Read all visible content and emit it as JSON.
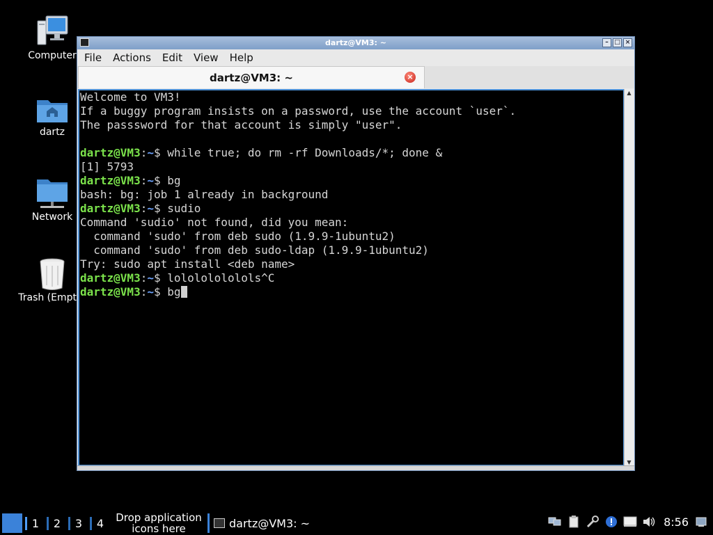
{
  "desktop": {
    "icons": [
      {
        "label": "Computer",
        "icon": "computer-icon"
      },
      {
        "label": "dartz",
        "icon": "home-folder-icon"
      },
      {
        "label": "Network",
        "icon": "network-folder-icon"
      },
      {
        "label": "Trash (Empty)",
        "icon": "trash-icon"
      }
    ]
  },
  "window": {
    "title": "dartz@VM3: ~",
    "menu": [
      "File",
      "Actions",
      "Edit",
      "View",
      "Help"
    ],
    "tab": {
      "label": "dartz@VM3: ~"
    }
  },
  "terminal": {
    "prompt_user": "dartz@VM3",
    "prompt_sep": ":",
    "prompt_path": "~",
    "prompt_end": "$ ",
    "lines": [
      {
        "type": "out",
        "text": "Welcome to VM3!"
      },
      {
        "type": "out",
        "text": "If a buggy program insists on a password, use the account `user`."
      },
      {
        "type": "out",
        "text": "The passsword for that account is simply \"user\"."
      },
      {
        "type": "out",
        "text": ""
      },
      {
        "type": "cmd",
        "text": "while true; do rm -rf Downloads/*; done &"
      },
      {
        "type": "out",
        "text": "[1] 5793"
      },
      {
        "type": "cmd",
        "text": "bg"
      },
      {
        "type": "out",
        "text": "bash: bg: job 1 already in background"
      },
      {
        "type": "cmd",
        "text": "sudio"
      },
      {
        "type": "out",
        "text": "Command 'sudio' not found, did you mean:"
      },
      {
        "type": "out",
        "text": "  command 'sudo' from deb sudo (1.9.9-1ubuntu2)"
      },
      {
        "type": "out",
        "text": "  command 'sudo' from deb sudo-ldap (1.9.9-1ubuntu2)"
      },
      {
        "type": "out",
        "text": "Try: sudo apt install <deb name>"
      },
      {
        "type": "cmd",
        "text": "lolololololols^C"
      },
      {
        "type": "cmd",
        "text": "bg",
        "cursor": true
      }
    ]
  },
  "taskbar": {
    "workspaces": [
      "1",
      "2",
      "3",
      "4"
    ],
    "drop_text_1": "Drop application",
    "drop_text_2": "icons here",
    "task_label": "dartz@VM3: ~",
    "clock": "8:56",
    "tray_icons": [
      "network-icon",
      "clipboard-icon",
      "tools-icon",
      "update-alert-icon",
      "display-icon",
      "volume-icon",
      "network-status-icon"
    ]
  },
  "colors": {
    "prompt_user": "#7be24b",
    "prompt_path": "#6ea4ff",
    "terminal_bg": "#000000",
    "accent": "#3b82d9"
  }
}
